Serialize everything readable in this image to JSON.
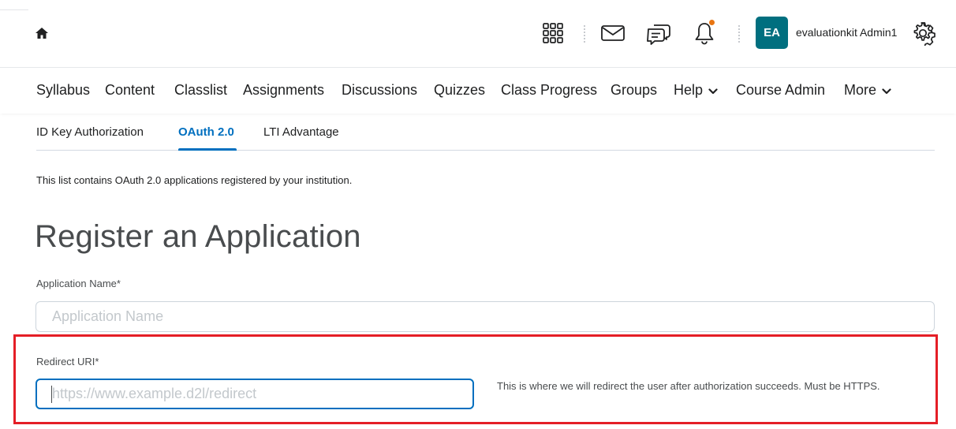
{
  "header": {
    "icons": {
      "home": "home-icon",
      "apps": "grid-icon",
      "mail": "mail-icon",
      "chat": "chat-icon",
      "notifications": "bell-icon",
      "settings": "gear-icon"
    },
    "avatar_initials": "EA",
    "avatar_color": "#006f7f",
    "notification_dot_color": "#e87511",
    "user_name": "evaluationkit Admin1"
  },
  "course_nav": {
    "items": [
      {
        "label": "Syllabus",
        "has_dropdown": false
      },
      {
        "label": "Content",
        "has_dropdown": false
      },
      {
        "label": "Classlist",
        "has_dropdown": false
      },
      {
        "label": "Assignments",
        "has_dropdown": false
      },
      {
        "label": "Discussions",
        "has_dropdown": false
      },
      {
        "label": "Quizzes",
        "has_dropdown": false
      },
      {
        "label": "Class Progress",
        "has_dropdown": false
      },
      {
        "label": "Groups",
        "has_dropdown": false
      },
      {
        "label": "Help",
        "has_dropdown": true
      },
      {
        "label": "Course Admin",
        "has_dropdown": false
      },
      {
        "label": "More",
        "has_dropdown": true
      }
    ]
  },
  "sub_tabs": {
    "items": [
      {
        "label": "ID Key Authorization",
        "active": false
      },
      {
        "label": "OAuth 2.0",
        "active": true
      },
      {
        "label": "LTI Advantage",
        "active": false
      }
    ],
    "active_color": "#006fbf"
  },
  "main": {
    "intro_text": "This list contains OAuth 2.0 applications registered by your institution.",
    "title": "Register an Application",
    "app_name": {
      "label": "Application Name*",
      "placeholder": "Application Name",
      "value": ""
    },
    "redirect_uri": {
      "label": "Redirect URI*",
      "placeholder": "https://www.example.d2l/redirect",
      "value": "",
      "help": "This is where we will redirect the user after authorization succeeds. Must be HTTPS."
    },
    "highlight_color": "#e41e26"
  }
}
